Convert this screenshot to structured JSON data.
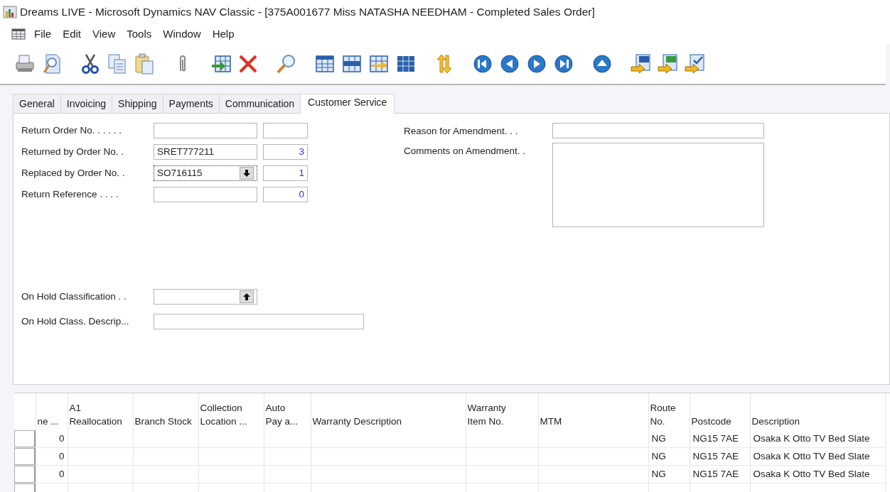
{
  "window": {
    "title": "Dreams LIVE - Microsoft Dynamics NAV Classic - [375A001677 Miss NATASHA NEEDHAM - Completed Sales Order]"
  },
  "menu": [
    "File",
    "Edit",
    "View",
    "Tools",
    "Window",
    "Help"
  ],
  "tabs": [
    {
      "label": "General",
      "selected": false
    },
    {
      "label": "Invoicing",
      "selected": false
    },
    {
      "label": "Shipping",
      "selected": false
    },
    {
      "label": "Payments",
      "selected": false
    },
    {
      "label": "Communication",
      "selected": false
    },
    {
      "label": "Customer Service",
      "selected": true
    }
  ],
  "left_fields": [
    {
      "label": "Return Order No. . . . . .",
      "kind": "plain",
      "focused": false
    },
    {
      "label": "Returned by Order No. .",
      "value": "SRET777211",
      "number": "3",
      "kind": "plain",
      "focused": false
    },
    {
      "label": "Replaced by Order No. .",
      "value": "SO716115",
      "number": "1",
      "kind": "lookup-down",
      "focused": true
    },
    {
      "label": "Return Reference . . . .",
      "number": "0",
      "kind": "plain",
      "focused": false
    }
  ],
  "hold_fields": [
    {
      "label": "On Hold Classification . .",
      "kind": "lookup-up"
    },
    {
      "label": "On Hold Class. Descrip...",
      "kind": "wide"
    }
  ],
  "right_fields": [
    {
      "label": "Reason for Amendment. . .",
      "kind": "line"
    },
    {
      "label": "Comments on Amendment. .",
      "kind": "memo"
    }
  ],
  "grid": {
    "columns": [
      {
        "header": [
          "ne ..."
        ]
      },
      {
        "header": [
          "A1",
          "Reallocation"
        ]
      },
      {
        "header": [
          "Branch Stock"
        ]
      },
      {
        "header": [
          "Collection",
          "Location ..."
        ]
      },
      {
        "header": [
          "Auto",
          "Pay a..."
        ]
      },
      {
        "header": [
          "Warranty Description"
        ]
      },
      {
        "header": [
          "Warranty",
          "Item No."
        ]
      },
      {
        "header": [
          "MTM"
        ]
      },
      {
        "header": [
          "Route",
          "No."
        ]
      },
      {
        "header": [
          "Postcode"
        ]
      },
      {
        "header": [
          "Description"
        ]
      }
    ],
    "rows": [
      {
        "column_1": "0",
        "route_no": "NG",
        "postcode": "NG15 7AE",
        "description": "Osaka K Otto TV Bed Slate"
      },
      {
        "column_1": "0",
        "route_no": "NG",
        "postcode": "NG15 7AE",
        "description": "Osaka K Otto TV Bed Slate"
      },
      {
        "column_1": "0",
        "route_no": "NG",
        "postcode": "NG15 7AE",
        "description": "Osaka K Otto TV Bed Slate"
      }
    ]
  }
}
